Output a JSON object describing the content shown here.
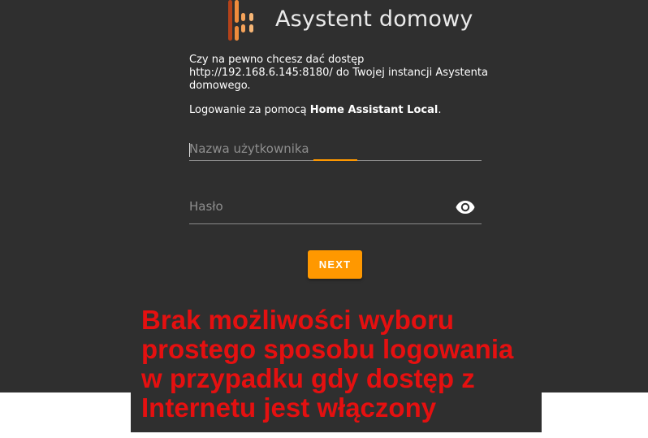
{
  "header": {
    "title": "Asystent domowy"
  },
  "authorize": {
    "description": "Czy na pewno chcesz dać dostęp http://192.168.6.145:8180/ do Twojej instancji Asystenta domowego.",
    "login_prefix": "Logowanie za pomocą ",
    "provider_name": "Home Assistant Local",
    "login_suffix": "."
  },
  "form": {
    "username_placeholder": "Nazwa użytkownika",
    "password_placeholder": "Hasło",
    "next_label": "NEXT"
  },
  "annotation": {
    "lines": [
      "Brak możliwości wyboru",
      "prostego sposobu logowania",
      "w przypadku gdy dostęp z",
      "Internetu jest włączony"
    ]
  },
  "colors": {
    "background": "#2f2f2f",
    "accent": "#ff9800",
    "annotation": "#e51010"
  },
  "icons": {
    "logo": "home-assistant-logo-icon",
    "show_password": "eye-icon"
  }
}
